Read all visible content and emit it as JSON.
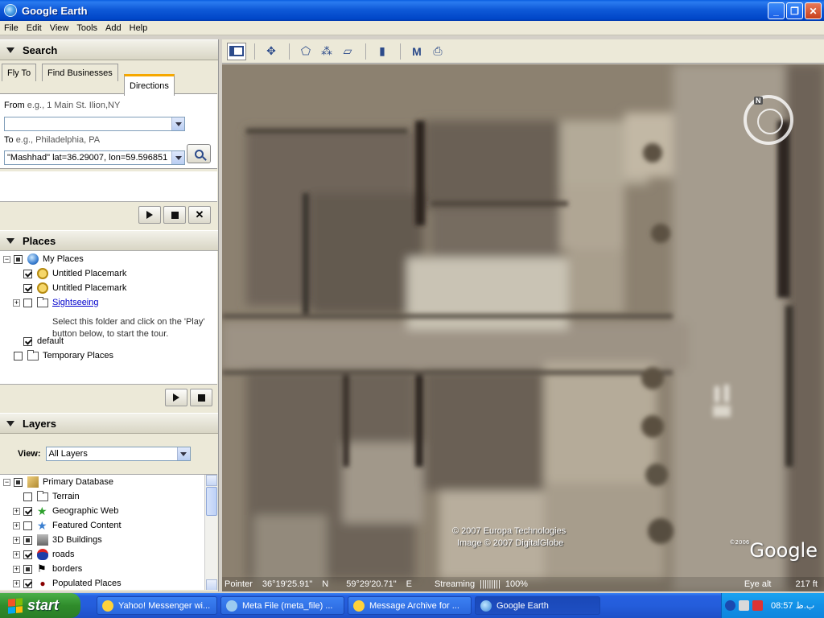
{
  "window": {
    "title": "Google Earth"
  },
  "menu": [
    "File",
    "Edit",
    "View",
    "Tools",
    "Add",
    "Help"
  ],
  "search": {
    "header": "Search",
    "tabs": [
      "Fly To",
      "Find Businesses",
      "Directions"
    ],
    "active_tab": "Directions",
    "from_label": "From",
    "from_hint": "e.g., 1 Main St. Ilion,NY",
    "from_value": "",
    "to_label": "To",
    "to_hint": "e.g., Philadelphia, PA",
    "to_value": "\"Mashhad\" lat=36.29007, lon=59.596851"
  },
  "places": {
    "header": "Places",
    "items": [
      {
        "label": "My Places"
      },
      {
        "label": "Untitled Placemark"
      },
      {
        "label": "Untitled Placemark"
      },
      {
        "label": "Sightseeing"
      },
      {
        "label": "default"
      },
      {
        "label": "Temporary Places"
      }
    ],
    "sightseeing_desc": "Select this folder and click on the 'Play' button below, to start the tour."
  },
  "layers": {
    "header": "Layers",
    "view_label": "View:",
    "view_value": "All Layers",
    "items": [
      {
        "label": "Primary Database"
      },
      {
        "label": "Terrain"
      },
      {
        "label": "Geographic Web"
      },
      {
        "label": "Featured Content"
      },
      {
        "label": "3D Buildings"
      },
      {
        "label": "roads"
      },
      {
        "label": "borders"
      },
      {
        "label": "Populated Places"
      }
    ]
  },
  "map": {
    "copyright1": "© 2007 Europa Technologies",
    "copyright2": "Image © 2007 DigitalGlobe",
    "logo_year": "©2006",
    "logo": "Google",
    "compass_label": "N",
    "status": {
      "pointer_label": "Pointer",
      "lat": "36°19'25.91\"",
      "lat_dir": "N",
      "lon": "59°29'20.71\"",
      "lon_dir": "E",
      "streaming_label": "Streaming",
      "streaming_bars": "|||||||||",
      "streaming_pct": "100%",
      "eye_label": "Eye alt",
      "eye_value": "217 ft"
    }
  },
  "taskbar": {
    "start": "start",
    "tasks": [
      {
        "label": "Yahoo! Messenger wi..."
      },
      {
        "label": "Meta File (meta_file) ..."
      },
      {
        "label": "Message Archive for ..."
      },
      {
        "label": "Google Earth"
      }
    ],
    "clock": "08:57 ب.ظ"
  },
  "colors": {
    "titlebar": "#0a5fe0",
    "taskbar": "#245ddb",
    "start_green": "#2f8c2b",
    "active_tab_accent": "#f6a800",
    "link": "#0000cc"
  }
}
